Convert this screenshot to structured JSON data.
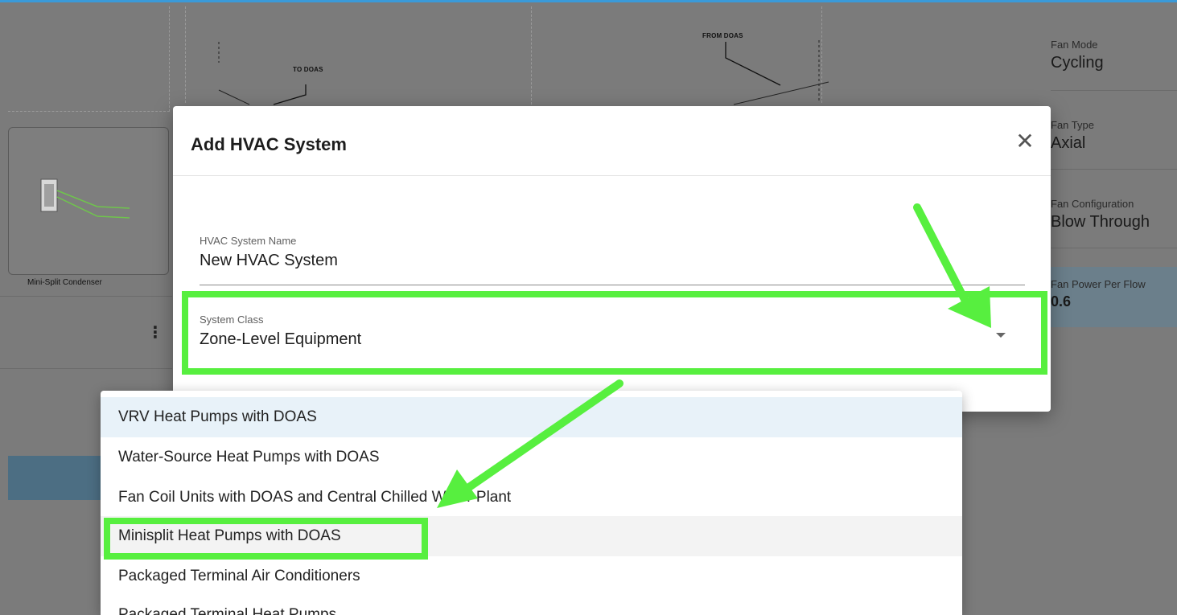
{
  "background": {
    "diagram": {
      "label_to": "TO DOAS",
      "label_from": "FROM DOAS"
    },
    "equipment_card": {
      "label": "Mini-Split Condenser",
      "menu_icon": "kebab-icon"
    },
    "properties": [
      {
        "label": "Fan Mode",
        "value": "Cycling"
      },
      {
        "label": "Fan Type",
        "value": "Axial"
      },
      {
        "label": "Fan Configuration",
        "value": "Blow Through"
      },
      {
        "label": "Fan Power Per Flow",
        "value": "0.6"
      }
    ]
  },
  "dialog": {
    "title": "Add HVAC System",
    "close_icon": "close-icon",
    "name_field": {
      "label": "HVAC System Name",
      "value": "New HVAC System"
    },
    "class_field": {
      "label": "System Class",
      "value": "Zone-Level Equipment",
      "icon": "dropdown-caret-icon"
    }
  },
  "dropdown": {
    "items": [
      "VRV Heat Pumps with DOAS",
      "Water-Source Heat Pumps with DOAS",
      "Fan Coil Units with DOAS and Central Chilled Water Plant",
      "Minisplit Heat Pumps with DOAS",
      "Packaged Terminal Air Conditioners",
      "Packaged Terminal Heat Pumps"
    ],
    "selected_index": 0,
    "hovered_index": 3
  },
  "annotations": {
    "color": "#57ef3f",
    "accent_selected": "#e8f2f9"
  }
}
